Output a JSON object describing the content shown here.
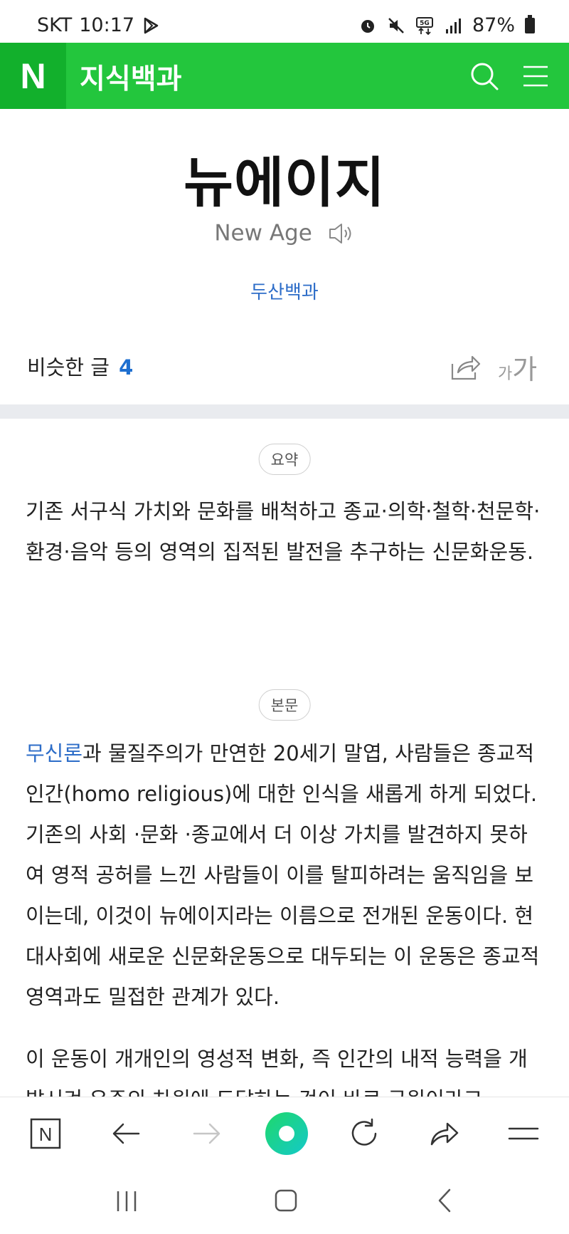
{
  "status_bar": {
    "carrier": "SKT",
    "time": "10:17",
    "battery": "87%"
  },
  "header": {
    "logo": "N",
    "title": "지식백과"
  },
  "article": {
    "title": "뉴에이지",
    "subtitle": "New Age",
    "source": "두산백과",
    "similar_label": "비슷한 글",
    "similar_count": "4",
    "font_small": "가",
    "font_big": "가"
  },
  "summary": {
    "label": "요약",
    "text": "기존 서구식 가치와 문화를 배척하고 종교·의학·철학·천문학·환경·음악 등의 영역의 집적된 발전을 추구하는 신문화운동."
  },
  "body": {
    "label": "본문",
    "link": "무신론",
    "p1_rest": "과 물질주의가 만연한 20세기 말엽, 사람들은 종교적 인간(homo religious)에 대한 인식을 새롭게 하게 되었다. 기존의 사회 ·문화 ·종교에서 더 이상 가치를 발견하지 못하여 영적 공허를 느낀 사람들이 이를 탈피하려는 움직임을 보이는데, 이것이 뉴에이지라는 이름으로 전개된 운동이다. 현대사회에 새로운 신문화운동으로 대두되는 이 운동은 종교적 영역과도 밀접한 관계가 있다.",
    "p2": "이 운동이 개개인의 영성적 변화, 즉 인간의 내적 능력을 개발시켜 우주의 차원에 도달하는 것이 바로 구원이라고"
  },
  "bottom_bar": {
    "home_label": "N"
  },
  "colors": {
    "brand_green": "#23c63d",
    "brand_green_dark": "#12b02c",
    "link_blue": "#2d6dc8"
  }
}
